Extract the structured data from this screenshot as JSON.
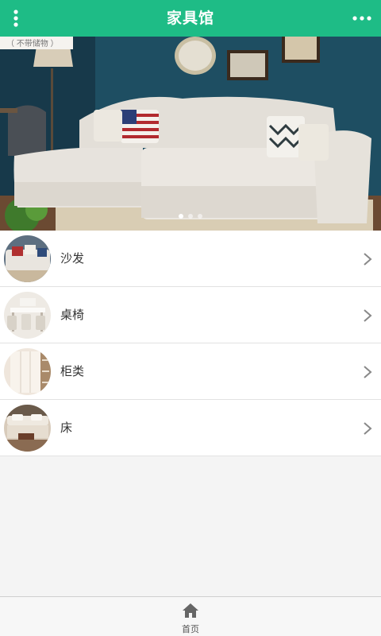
{
  "header": {
    "title": "家具馆",
    "menu_icon": "vertical-dots-icon",
    "more_icon": "horizontal-dots-icon",
    "background": "#1ebc86"
  },
  "banner": {
    "watermark": "（ 不带储物 ）",
    "slides": 3,
    "active_slide": 1
  },
  "categories": [
    {
      "label": "沙发",
      "icon": "sofa-thumbnail"
    },
    {
      "label": "桌椅",
      "icon": "table-chairs-thumbnail"
    },
    {
      "label": "柜类",
      "icon": "cabinet-thumbnail"
    },
    {
      "label": "床",
      "icon": "bed-thumbnail"
    }
  ],
  "bottom_nav": {
    "home_label": "首页",
    "home_icon": "home-icon"
  }
}
